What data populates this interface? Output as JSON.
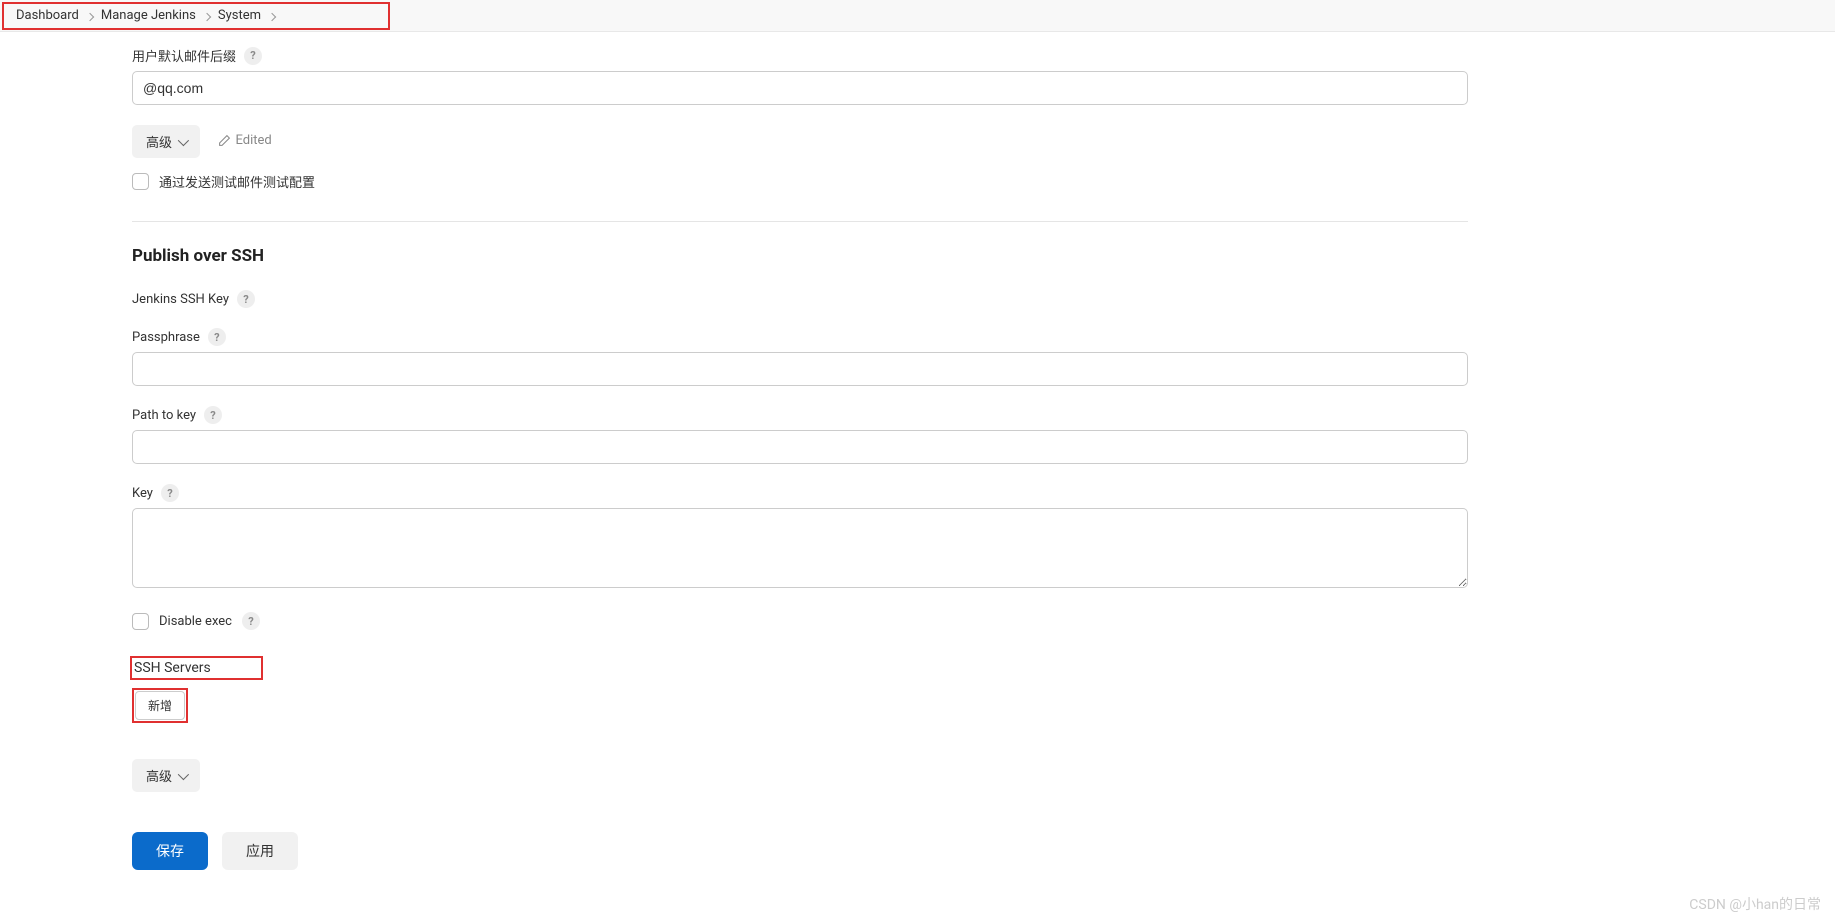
{
  "breadcrumb": {
    "items": [
      {
        "label": "Dashboard"
      },
      {
        "label": "Manage Jenkins"
      },
      {
        "label": "System"
      }
    ]
  },
  "emailSection": {
    "suffixLabel": "用户默认邮件后缀",
    "suffixValue": "@qq.com",
    "advancedLabel": "高级",
    "editedLabel": "Edited",
    "testCheckboxLabel": "通过发送测试邮件测试配置"
  },
  "sshSection": {
    "title": "Publish over SSH",
    "jenkinsKeyLabel": "Jenkins SSH Key",
    "passphraseLabel": "Passphrase",
    "passphraseValue": "",
    "pathToKeyLabel": "Path to key",
    "pathToKeyValue": "",
    "keyLabel": "Key",
    "keyValue": "",
    "disableExecLabel": "Disable exec",
    "sshServersLabel": "SSH Servers",
    "addButtonLabel": "新增",
    "advancedLabel": "高级"
  },
  "footer": {
    "saveLabel": "保存",
    "applyLabel": "应用"
  },
  "watermark": "CSDN @小han的日常"
}
